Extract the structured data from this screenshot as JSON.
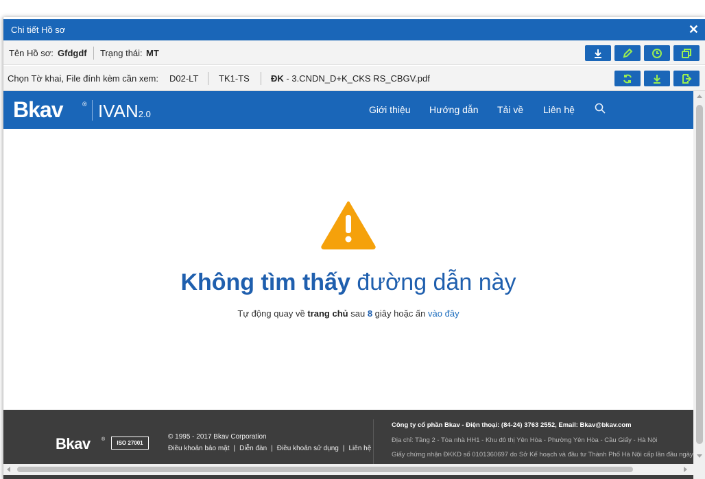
{
  "dialog": {
    "title": "Chi tiết Hồ sơ",
    "close_label": "✕"
  },
  "info_row": {
    "name_label": "Tên Hồ sơ:",
    "name_value": "Gfdgdf",
    "status_label": "Trạng thái:",
    "status_value": "MT",
    "buttons": [
      "download-icon",
      "edit-icon",
      "clock-icon",
      "copy-icon"
    ]
  },
  "file_row": {
    "label": "Chọn Tờ khai, File đính kèm cần xem:",
    "files": [
      "D02-LT",
      "TK1-TS"
    ],
    "selected_prefix": "ĐK",
    "selected_file": " - 3.CNDN_D+K_CKS RS_CBGV.pdf",
    "buttons": [
      "refresh-icon",
      "download-icon",
      "export-icon"
    ]
  },
  "site": {
    "brand": "Bkav",
    "brand_mark": "®",
    "product": "IVAN",
    "product_version": "2.0",
    "nav": [
      "Giới thiệu",
      "Hướng dẫn",
      "Tải về",
      "Liên hệ"
    ]
  },
  "error": {
    "heading_bold": "Không tìm thấy",
    "heading_light": "đường dẫn này",
    "sub_prefix": "Tự động quay về",
    "sub_home": "trang chủ",
    "sub_mid": "sau",
    "countdown": "8",
    "sub_mid2": "giây hoặc ấn",
    "sub_link": "vào đây"
  },
  "footer": {
    "brand": "Bkav",
    "iso": "ISO 27001",
    "copyright": "© 1995 - 2017 Bkav Corporation",
    "links": [
      "Điều khoản bảo mật",
      "Diễn đàn",
      "Điều khoản sử dụng",
      "Liên hệ"
    ],
    "company": "Công ty cổ phần Bkav - Điện thoại: (84-24) 3763 2552, Email: Bkav@bkav.com",
    "address": "Địa chỉ: Tầng 2 - Tòa nhà HH1 - Khu đô thị Yên Hòa - Phường Yên Hòa - Cầu Giấy - Hà Nội",
    "license": "Giấy chứng nhận ĐKKD số 0101360697 do Sở Kế hoạch và đầu tư Thành Phố Hà Nội cấp lần đầu ngày"
  },
  "colors": {
    "primary": "#1a66b8",
    "warning": "#f5a10b",
    "footer_bg": "#3d3d3d"
  }
}
